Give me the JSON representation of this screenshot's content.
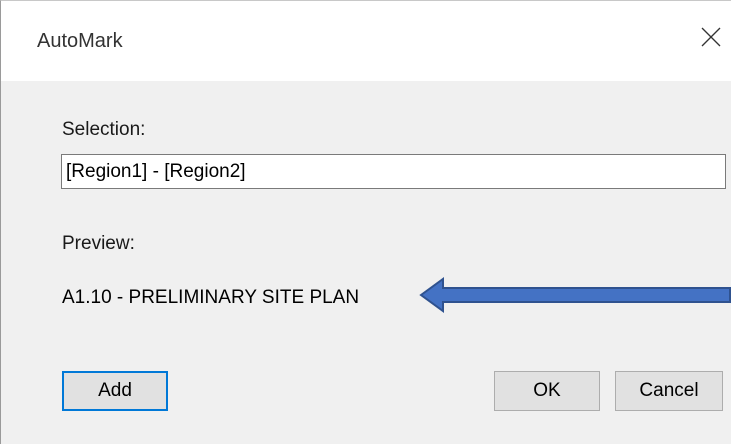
{
  "window": {
    "title": "AutoMark",
    "close_icon": "close-icon"
  },
  "selection": {
    "label": "Selection:",
    "value": "[Region1] - [Region2]"
  },
  "preview": {
    "label": "Preview:",
    "value": "A1.10 - PRELIMINARY SITE PLAN"
  },
  "annotation": {
    "arrow_icon": "left-arrow-icon",
    "fill_color": "#4472c4",
    "stroke_color": "#2f528f"
  },
  "buttons": {
    "add_label": "Add",
    "ok_label": "OK",
    "cancel_label": "Cancel"
  },
  "colors": {
    "focus_border": "#0078d7",
    "dialog_background": "#f0f0f0",
    "titlebar_background": "#ffffff"
  }
}
